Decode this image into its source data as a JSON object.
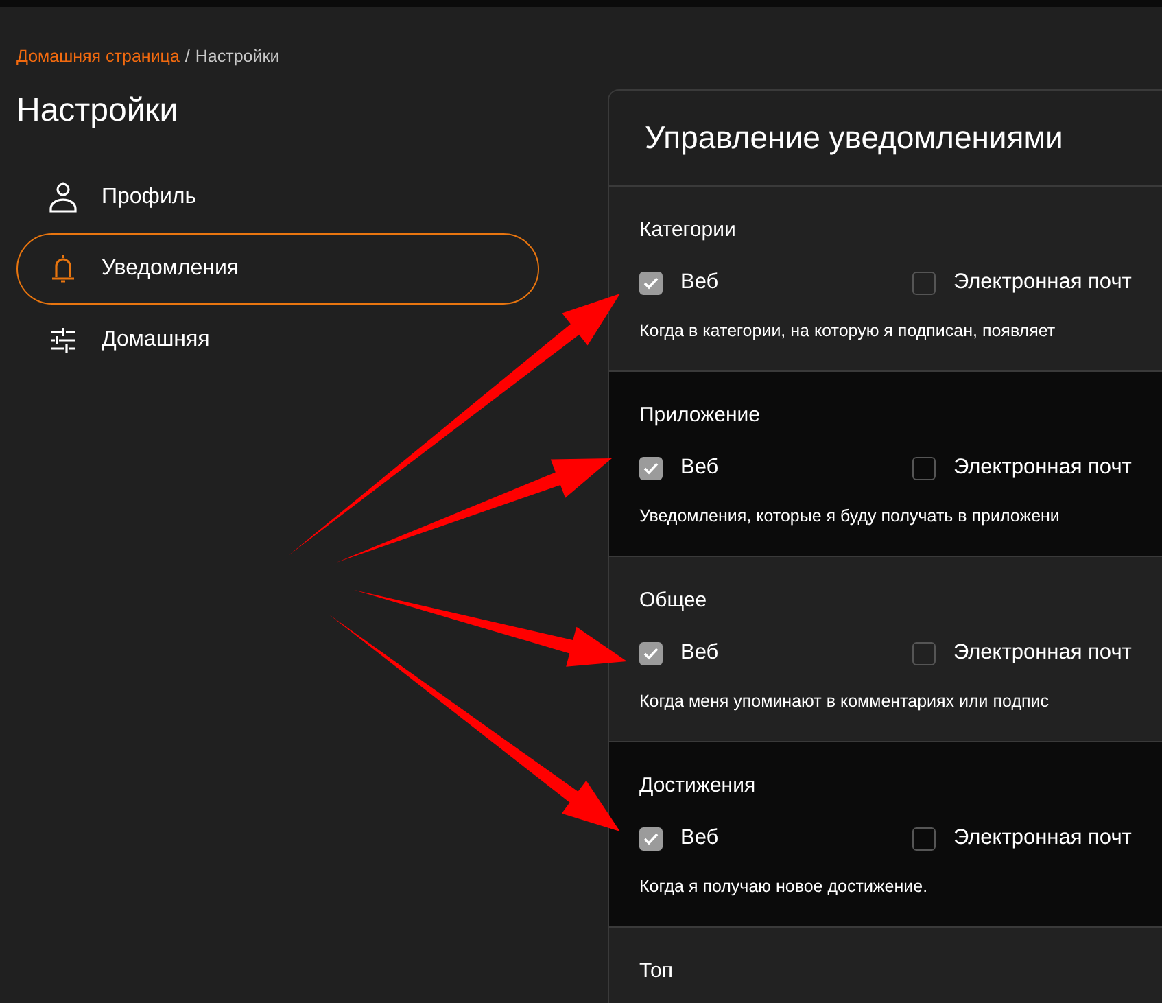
{
  "breadcrumb": [
    {
      "label": "Домашняя страница",
      "kind": "link"
    },
    {
      "label": "/",
      "kind": "separator"
    },
    {
      "label": "Настройки",
      "kind": "current"
    }
  ],
  "page_title": "Настройки",
  "nav": [
    {
      "label": "Профиль",
      "kind": "person",
      "selected": false
    },
    {
      "label": "Уведомления",
      "kind": "bell",
      "selected": true
    },
    {
      "label": "Домашняя",
      "kind": "sliders",
      "selected": false
    }
  ],
  "panel": {
    "title": "Управление уведомлениями",
    "sections": [
      {
        "title": "Категории",
        "options": [
          {
            "label": "Веб",
            "checked": true
          },
          {
            "label": "Электронная почт",
            "checked": false
          }
        ],
        "description": "Когда в категории, на которую я подписан, появляет"
      },
      {
        "title": "Приложение",
        "options": [
          {
            "label": "Веб",
            "checked": true
          },
          {
            "label": "Электронная почт",
            "checked": false
          }
        ],
        "description": "Уведомления, которые я буду получать в приложени"
      },
      {
        "title": "Общее",
        "options": [
          {
            "label": "Веб",
            "checked": true
          },
          {
            "label": "Электронная почт",
            "checked": false
          }
        ],
        "description": "Когда меня упоминают в комментариях или подпис"
      },
      {
        "title": "Достижения",
        "options": [
          {
            "label": "Веб",
            "checked": true
          },
          {
            "label": "Электронная почт",
            "checked": false
          }
        ],
        "description": "Когда я получаю новое достижение."
      },
      {
        "title": "Топ"
      }
    ]
  }
}
